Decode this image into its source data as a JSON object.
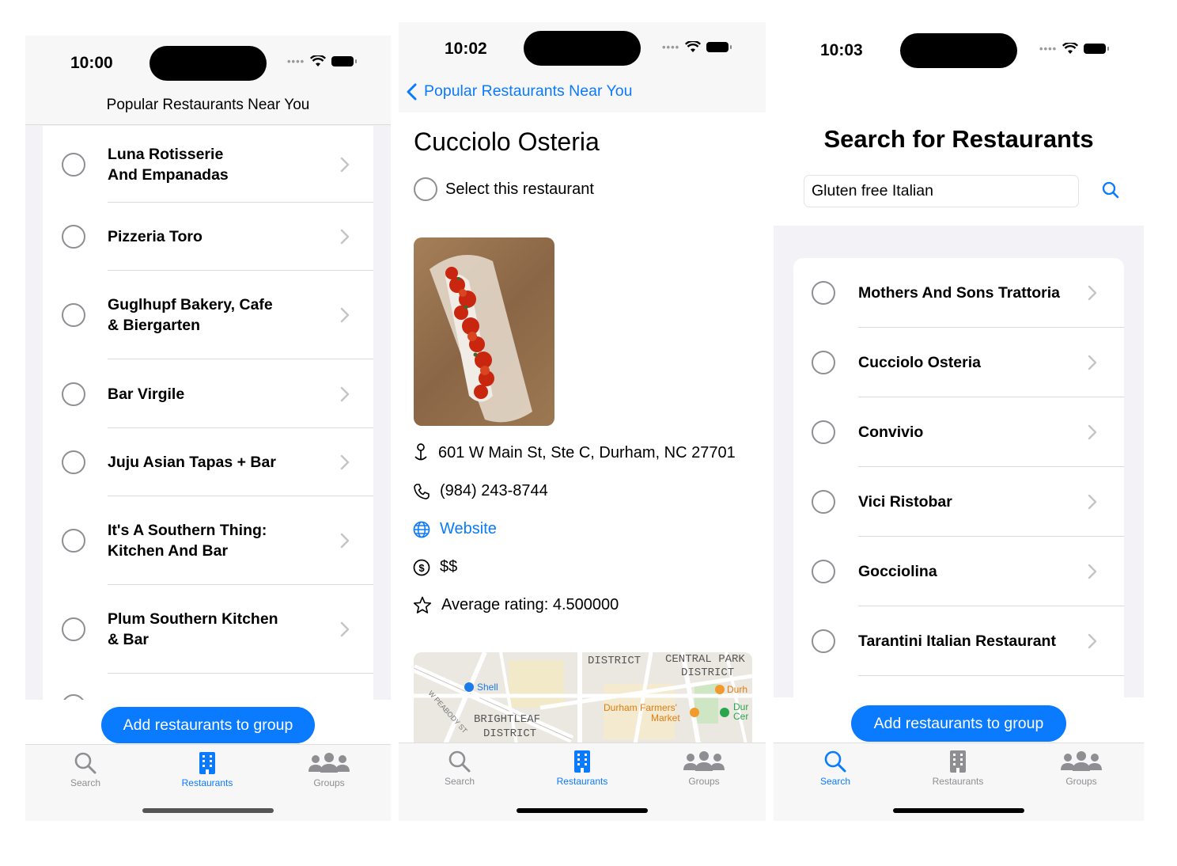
{
  "screens": [
    {
      "time": "10:00",
      "title": "Popular Restaurants Near You",
      "restaurants": [
        {
          "line1": "Luna Rotisserie",
          "line2": "And Empanadas"
        },
        {
          "line1": "Pizzeria Toro",
          "line2": ""
        },
        {
          "line1": "Guglhupf Bakery, Cafe",
          "line2": "& Biergarten"
        },
        {
          "line1": "Bar Virgile",
          "line2": ""
        },
        {
          "line1": "Juju Asian Tapas + Bar",
          "line2": ""
        },
        {
          "line1": "It's A Southern Thing:",
          "line2": "Kitchen And Bar"
        },
        {
          "line1": "Plum Southern Kitchen",
          "line2": "& Bar"
        }
      ],
      "add_button": "Add restaurants to group"
    },
    {
      "time": "10:02",
      "back_label": "Popular Restaurants Near You",
      "restaurant_name": "Cucciolo Osteria",
      "select_label": "Select this restaurant",
      "address": "601 W Main St, Ste C, Durham, NC 27701",
      "phone": "(984) 243-8744",
      "website": "Website",
      "price": "$$",
      "rating": "Average rating: 4.500000",
      "map_labels": {
        "district": "DISTRICT",
        "central_park_1": "CENTRAL PARK",
        "central_park_2": "DISTRICT",
        "shell": "Shell",
        "durh": "Durh",
        "farmers_1": "Durham Farmers'",
        "farmers_2": "Market",
        "dur": "Dur",
        "cer": "Cer",
        "brightleaf_1": "BRIGHTLEAF",
        "brightleaf_2": "DISTRICT",
        "peabody": "W PEABODY ST"
      }
    },
    {
      "time": "10:03",
      "title": "Search for Restaurants",
      "search_value": "Gluten free Italian",
      "results": [
        "Mothers And Sons Trattoria",
        "Cucciolo Osteria",
        "Convivio",
        "Vici Ristobar",
        "Gocciolina",
        "Tarantini Italian Restaurant"
      ],
      "add_button": "Add restaurants to group"
    }
  ],
  "tabs": {
    "search": "Search",
    "restaurants": "Restaurants",
    "groups": "Groups"
  },
  "colors": {
    "accent": "#0a7aff",
    "inactive_tab": "#8e8e93",
    "grouped_background": "#f2f2f7"
  },
  "icons": [
    "search-icon",
    "building-icon",
    "groups-icon",
    "chevron-right-icon",
    "chevron-left-icon",
    "location-pin-icon",
    "phone-icon",
    "globe-icon",
    "dollar-circle-icon",
    "star-icon",
    "wifi-icon",
    "battery-icon",
    "magnifier-icon"
  ]
}
